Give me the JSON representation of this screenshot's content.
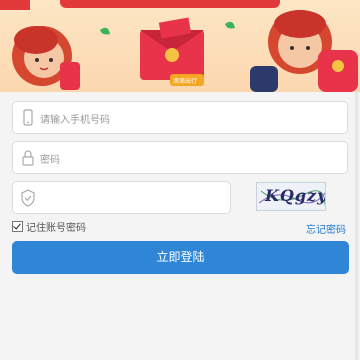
{
  "banner": {
    "badge_text": "滴滴出行"
  },
  "form": {
    "phone": {
      "placeholder": "请输入手机号码",
      "icon": "phone-icon"
    },
    "password": {
      "placeholder": "密码",
      "icon": "lock-icon"
    },
    "captcha": {
      "placeholder": "",
      "icon": "shield-icon",
      "code": "KQgzy"
    }
  },
  "remember_label": "记住账号密码",
  "forgot_label": "忘记密码",
  "login_label": "立即登陆",
  "colors": {
    "accent": "#2f86d6",
    "link": "#1e7ad6",
    "banner_red": "#e8334a"
  }
}
